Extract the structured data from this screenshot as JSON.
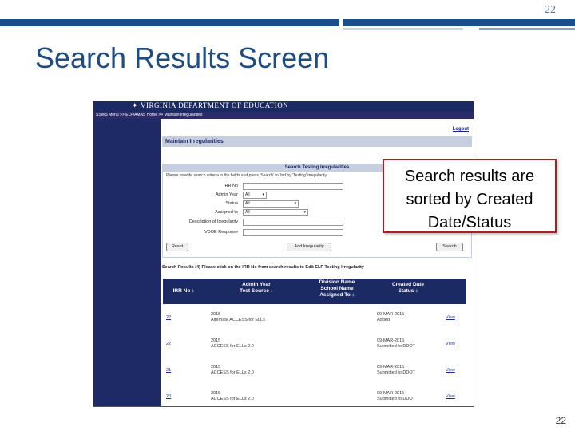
{
  "slide": {
    "number_top": "22",
    "title": "Search Results Screen",
    "number_bottom": "22",
    "callout": [
      "Search results are",
      "sorted by Created",
      "Date/Status"
    ]
  },
  "app": {
    "logo": "VIRGINIA DEPARTMENT OF EDUCATION",
    "breadcrumb": "SSWS Menu >> ELP/AMAS Home >> Maintain Irregularities",
    "logout": "Logout",
    "page_heading": "Maintain Irregularities",
    "search": {
      "title": "Search Testing Irregularities",
      "instructions": "Please provide search criteria in the fields and press 'Search' to find by 'Testing' Irregularity",
      "fields": [
        {
          "label": "IRR No",
          "value": ""
        },
        {
          "label": "Admin Year",
          "value": "All"
        },
        {
          "label": "Status",
          "value": "All"
        },
        {
          "label": "Assigned to",
          "value": "All"
        },
        {
          "label": "Description of Irregularity",
          "value": ""
        },
        {
          "label": "VDOE Response",
          "value": ""
        }
      ],
      "reset_label": "Reset",
      "add_label": "Add Irregularity",
      "search_label": "Search"
    },
    "results": {
      "instructions": "Search Results (4) Please click on the IRR No from search results to Edit ELP Testing Irregularity",
      "headers": {
        "irr": "IRR No ↕",
        "admin": "Admin Year\nTest Source ↕",
        "division": "Division Name\nSchool Name\nAssigned To ↕",
        "created": "Created Date\nStatus ↕"
      },
      "rows": [
        {
          "irr": "22",
          "year": "2015",
          "test": "Alternate ACCESS for ELLs",
          "date": "09-MAR-2015",
          "status": "Added",
          "action": "View"
        },
        {
          "irr": "22",
          "year": "2015",
          "test": "ACCESS for ELLs 2.0",
          "date": "09-MAR-2015",
          "status": "Submitted to DDOT",
          "action": "View"
        },
        {
          "irr": "21",
          "year": "2015",
          "test": "ACCESS for ELLs 2.0",
          "date": "09-MAR-2015",
          "status": "Submitted to DDOT",
          "action": "View"
        },
        {
          "irr": "20",
          "year": "2015",
          "test": "ACCESS for ELLs 2.0",
          "date": "09-MAR-2015",
          "status": "Submitted to DDOT",
          "action": "View"
        }
      ]
    }
  }
}
